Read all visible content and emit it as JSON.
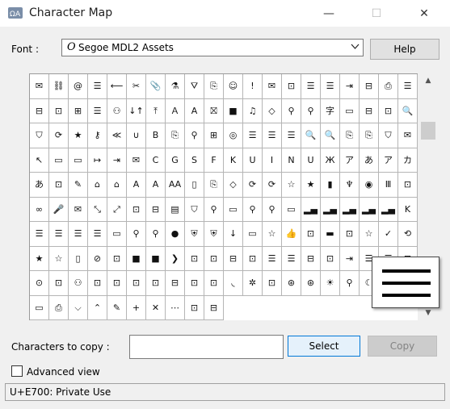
{
  "window": {
    "title": "Character Map",
    "controls": {
      "minimize": "—",
      "maximize": "☐",
      "close": "✕"
    }
  },
  "font": {
    "label": "Font :",
    "icon_glyph": "O",
    "value": "Segoe MDL2 Assets",
    "dropdown_glyph": "⌵"
  },
  "buttons": {
    "help": "Help",
    "select": "Select",
    "copy": "Copy"
  },
  "grid": {
    "selected_index": 0,
    "cells": [
      "✉",
      "⛓",
      "@",
      "☰",
      "⟵",
      "✂",
      "📎",
      "⚗",
      "⛛",
      "⎘",
      "☺",
      "!",
      "✉",
      "⊡",
      "☰",
      "☰",
      "⇥",
      "⊟",
      "⎙",
      "☰",
      "⊟",
      "⊡",
      "⊞",
      "☰",
      "⚇",
      "↓↑",
      "⤒",
      "Ａ",
      "A",
      "⛝",
      "■",
      "♫",
      "◇",
      "⚲",
      "⚲",
      "字",
      "▭",
      "⊟",
      "⊡",
      "🔍",
      "⛉",
      "⟳",
      "★",
      "⚷",
      "≪",
      "∪",
      "B",
      "⎘",
      "⚲",
      "⊞",
      "◎",
      "☰",
      "☰",
      "☰",
      "🔍",
      "🔍",
      "⎘",
      "⎘",
      "⛉",
      "✉",
      "↖",
      "▭",
      "▭",
      "↦",
      "⇥",
      "✉",
      "C",
      "G",
      "S",
      "F",
      "K",
      "U",
      "I",
      "N",
      "U",
      "Ж",
      "ア",
      "あ",
      "ア",
      "カ",
      "あ",
      "⊡",
      "✎",
      "⌂",
      "⌂",
      "A",
      "A",
      "AA",
      "▯",
      "⎘",
      "◇",
      "⟳",
      "⟳",
      "☆",
      "★",
      "▮",
      "♆",
      "◉",
      "Ⅲ",
      "⊡",
      "∞",
      "🎤",
      "✉",
      "⤡",
      "⤢",
      "⊡",
      "⊟",
      "▤",
      "⛉",
      "⚲",
      "▭",
      "⚲",
      "⚲",
      "▭",
      "▂▄",
      "▂▄",
      "▂▄",
      "▂▄",
      "▂▄",
      "K",
      "☰",
      "☰",
      "☰",
      "☰",
      "▭",
      "⚲",
      "⚲",
      "●",
      "⛨",
      "⛨",
      "↓",
      "▭",
      "☆",
      "👍",
      "⊡",
      "▬",
      "⊡",
      "☆",
      "✓",
      "⟲",
      "★",
      "☆",
      "▯",
      "⊘",
      "⊡",
      "■",
      "■",
      "❯",
      "⊡",
      "⊡",
      "⊟",
      "⊡",
      "☰",
      "☰",
      "⊟",
      "⊡",
      "⇥",
      "☰",
      "☰",
      "⊟",
      "⊙",
      "⊡",
      "⚇",
      "⊡",
      "⊡",
      "⊡",
      "⊡",
      "⊟",
      "⊡",
      "⊡",
      "◟",
      "✲",
      "⊡",
      "⊛",
      "⊛",
      "☀",
      "⚲",
      "☾",
      "⚒",
      "▭",
      "▭",
      "⎙",
      "⌵",
      "⌃",
      "✎",
      "+",
      "✕",
      "⋯",
      "⊡",
      "⊟"
    ]
  },
  "zoom": {
    "glyph": "hamburger"
  },
  "copy_field": {
    "label": "Characters to copy :",
    "value": ""
  },
  "advanced_view": {
    "label": "Advanced view",
    "checked": false
  },
  "status": {
    "text": "U+E700: Private Use"
  },
  "colors": {
    "accent": "#0078d7",
    "select_bg": "#e5f1fb",
    "grid_border": "#b5b5b5"
  }
}
